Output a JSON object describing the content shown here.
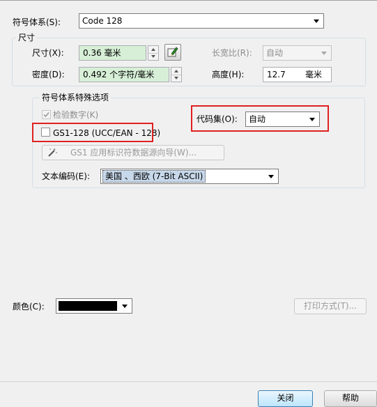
{
  "symbology": {
    "label": "符号体系(S):",
    "value": "Code 128"
  },
  "size_group": {
    "title": "尺寸",
    "size": {
      "label": "尺寸(X):",
      "value": "0.36 毫米"
    },
    "density": {
      "label": "密度(D):",
      "value": "0.492 个字符/毫米"
    },
    "aspect": {
      "label": "长宽比(R):",
      "value": "自动"
    },
    "height": {
      "label": "高度(H):",
      "value": "12.7",
      "unit": "毫米"
    }
  },
  "options_group": {
    "title": "符号体系特殊选项",
    "check_digit": {
      "label": "检验数字(K)",
      "checked": true
    },
    "gs1": {
      "label": "GS1-128 (UCC/EAN - 128)",
      "checked": false
    },
    "codeset": {
      "label": "代码集(O):",
      "value": "自动"
    },
    "gs1_wizard_label": "GS1 应用标识符数据源向导(W)...",
    "encoding": {
      "label": "文本编码(E):",
      "value": "美国 、西欧 (7-Bit ASCII)"
    }
  },
  "color": {
    "label": "颜色(C):",
    "swatch": "#000000"
  },
  "print_method_label": "打印方式(T)...",
  "buttons": {
    "close": "关闭",
    "help": "帮助"
  },
  "colors": {
    "highlight_border": "#e02020",
    "green_field": "#d7efd7"
  }
}
